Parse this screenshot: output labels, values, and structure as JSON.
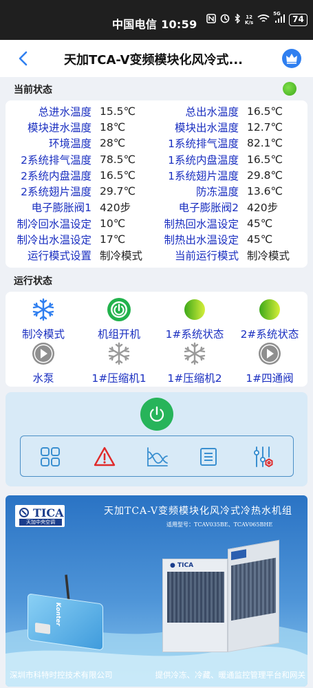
{
  "statusbar": {
    "carrier_time": "中国电信 10:59",
    "net_speed_top": "12",
    "net_speed_bottom": "K/s",
    "signal_label": "5G",
    "battery": "74"
  },
  "header": {
    "title": "天加TCA-V变频模块化风冷式..."
  },
  "current_status": {
    "section_label": "当前状态",
    "online_color": "#4cc12a",
    "rows": [
      {
        "l1": "总进水温度",
        "v1": "15.5℃",
        "l2": "总出水温度",
        "v2": "16.5℃"
      },
      {
        "l1": "模块进水温度",
        "v1": "18℃",
        "l2": "模块出水温度",
        "v2": "12.7℃"
      },
      {
        "l1": "环境温度",
        "v1": "28℃",
        "l2": "1系统排气温度",
        "v2": "82.1℃"
      },
      {
        "l1": "2系统排气温度",
        "v1": "78.5℃",
        "l2": "1系统内盘温度",
        "v2": "16.5℃"
      },
      {
        "l1": "2系统内盘温度",
        "v1": "16.5℃",
        "l2": "1系统翅片温度",
        "v2": "29.8℃"
      },
      {
        "l1": "2系统翅片温度",
        "v1": "29.7℃",
        "l2": "防冻温度",
        "v2": "13.6℃"
      },
      {
        "l1": "电子膨胀阀1",
        "v1": "420步",
        "l2": "电子膨胀阀2",
        "v2": "420步"
      },
      {
        "l1": "制冷回水温设定",
        "v1": "10℃",
        "l2": "制热回水温设定",
        "v2": "45℃"
      },
      {
        "l1": "制冷出水温设定",
        "v1": "17℃",
        "l2": "制热出水温设定",
        "v2": "45℃"
      },
      {
        "l1": "运行模式设置",
        "v1": "制冷模式",
        "l2": "当前运行模式",
        "v2": "制冷模式"
      }
    ]
  },
  "run_status": {
    "section_label": "运行状态",
    "items": [
      {
        "label": "制冷模式",
        "icon": "snowflake-icon-blue"
      },
      {
        "label": "机组开机",
        "icon": "power-on-icon"
      },
      {
        "label": "1#系统状态",
        "icon": "green-ball-icon"
      },
      {
        "label": "2#系统状态",
        "icon": "green-ball-icon"
      },
      {
        "label": "水泵",
        "icon": "play-gray-icon"
      },
      {
        "label": "1#压缩机1",
        "icon": "snowflake-icon-gray"
      },
      {
        "label": "1#压缩机2",
        "icon": "snowflake-icon-gray"
      },
      {
        "label": "1#四通阀",
        "icon": "play-gray-icon"
      }
    ]
  },
  "controls": {
    "power_icon": "power-button-icon",
    "tools": [
      "grid-icon",
      "alarm-icon",
      "chart-icon",
      "list-icon",
      "settings-sliders-icon"
    ],
    "accent": "#27b45a",
    "alarm_color": "#e02a2a",
    "tool_color": "#3a8fd0"
  },
  "banner": {
    "logo": "TICA",
    "logo_sub": "天加中央空调",
    "title": "天加TCA-V变频模块化风冷式冷热水机组",
    "models": "适用型号：TCAV035BE、TCAV065BHE",
    "footer_left": "深圳市科特时控技术有限公司",
    "footer_right": "提供冷冻、冷藏、暖通监控管理平台和网关",
    "device_label": "Konter"
  }
}
